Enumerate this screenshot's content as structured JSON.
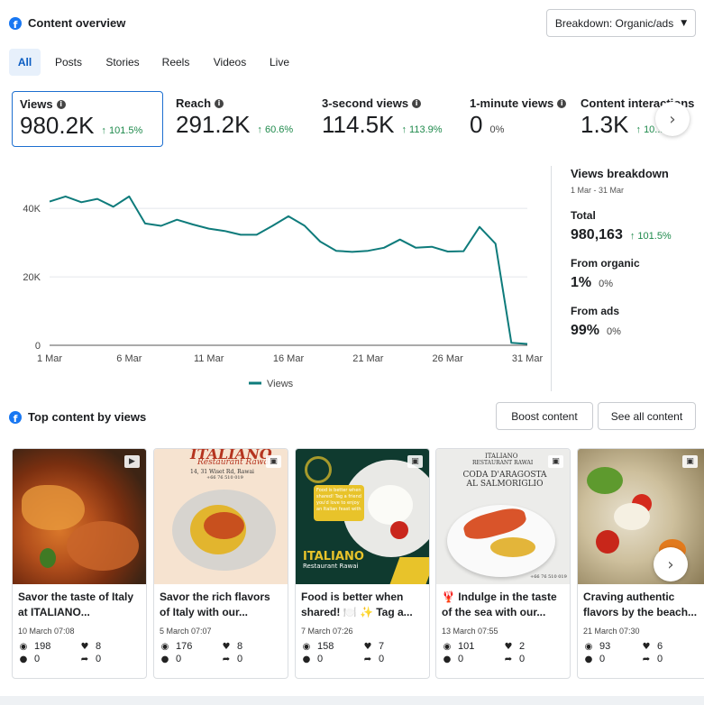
{
  "header": {
    "title": "Content overview",
    "breakdown_button": "Breakdown: Organic/ads"
  },
  "tabs": [
    {
      "label": "All",
      "active": true
    },
    {
      "label": "Posts",
      "active": false
    },
    {
      "label": "Stories",
      "active": false
    },
    {
      "label": "Reels",
      "active": false
    },
    {
      "label": "Videos",
      "active": false
    },
    {
      "label": "Live",
      "active": false
    }
  ],
  "metrics": [
    {
      "label": "Views",
      "value": "980.2K",
      "delta": "101.5%",
      "active": true,
      "has_arrow": true
    },
    {
      "label": "Reach",
      "value": "291.2K",
      "delta": "60.6%",
      "active": false,
      "has_arrow": true
    },
    {
      "label": "3-second views",
      "value": "114.5K",
      "delta": "113.9%",
      "active": false,
      "has_arrow": true
    },
    {
      "label": "1-minute views",
      "value": "0",
      "delta": "0%",
      "active": false,
      "has_arrow": false
    },
    {
      "label": "Content interactions",
      "value": "1.3K",
      "delta": "10...",
      "active": false,
      "has_arrow": true
    }
  ],
  "chart_data": {
    "type": "line",
    "title": "",
    "xlabel": "",
    "ylabel": "",
    "x": [
      "1 Mar",
      "2 Mar",
      "3 Mar",
      "4 Mar",
      "5 Mar",
      "6 Mar",
      "7 Mar",
      "8 Mar",
      "9 Mar",
      "10 Mar",
      "11 Mar",
      "12 Mar",
      "13 Mar",
      "14 Mar",
      "15 Mar",
      "16 Mar",
      "17 Mar",
      "18 Mar",
      "19 Mar",
      "20 Mar",
      "21 Mar",
      "22 Mar",
      "23 Mar",
      "24 Mar",
      "25 Mar",
      "26 Mar",
      "27 Mar",
      "28 Mar",
      "29 Mar",
      "30 Mar",
      "31 Mar"
    ],
    "x_tick_labels": [
      "1 Mar",
      "6 Mar",
      "11 Mar",
      "16 Mar",
      "21 Mar",
      "26 Mar",
      "31 Mar"
    ],
    "y_tick_labels": [
      "0",
      "20K",
      "40K"
    ],
    "ylim": [
      0,
      44000
    ],
    "grid": true,
    "legend": "bottom-center",
    "series": [
      {
        "name": "Views",
        "color": "#0e7b7b",
        "values": [
          42000,
          43500,
          41800,
          42800,
          40500,
          43500,
          35600,
          34900,
          36700,
          35300,
          34100,
          33400,
          32300,
          32300,
          34900,
          37700,
          35000,
          30300,
          27600,
          27300,
          27600,
          28500,
          30900,
          28500,
          28800,
          27400,
          27500,
          34600,
          29700,
          700,
          400
        ]
      }
    ]
  },
  "breakdown": {
    "title": "Views breakdown",
    "date_range": "1 Mar - 31 Mar",
    "items": [
      {
        "label": "Total",
        "value": "980,163",
        "delta": "101.5%",
        "has_arrow": true
      },
      {
        "label": "From organic",
        "value": "1%",
        "delta": "0%",
        "has_arrow": false
      },
      {
        "label": "From ads",
        "value": "99%",
        "delta": "0%",
        "has_arrow": false
      }
    ]
  },
  "top_content": {
    "title": "Top content by views",
    "boost_button": "Boost content",
    "see_all_button": "See all content",
    "cards": [
      {
        "caption": "Savor the taste of Italy at ITALIANO...",
        "date": "10 March 07:08",
        "views": "198",
        "likes": "8",
        "comments": "0",
        "shares": "0",
        "type_icon": "video-icon"
      },
      {
        "caption": "Savor the rich flavors of Italy with our...",
        "date": "5 March 07:07",
        "views": "176",
        "likes": "8",
        "comments": "0",
        "shares": "0",
        "type_icon": "photo-icon",
        "thumb_title": "ITALIANO",
        "thumb_subtitle": "Restaurant Rawai",
        "thumb_address": "14, 31 Wiset Rd, Rawai",
        "thumb_phone": "+66 76 510 019"
      },
      {
        "caption": "Food is better when shared! 🍽️ ✨ Tag a...",
        "date": "7 March 07:26",
        "views": "158",
        "likes": "7",
        "comments": "0",
        "shares": "0",
        "type_icon": "photo-icon",
        "thumb_title": "ITALIANO",
        "thumb_subtitle": "Restaurant Rawai",
        "thumb_bubble": "Food is better when shared! Tag a friend you'd love to enjoy an Italian feast with"
      },
      {
        "caption": "🦞 Indulge in the taste of the sea with our...",
        "date": "13 March 07:55",
        "views": "101",
        "likes": "2",
        "comments": "0",
        "shares": "0",
        "type_icon": "photo-icon",
        "thumb_title": "ITALIANO",
        "thumb_subtitle": "RESTAURANT RAWAI",
        "thumb_dish": "CODA D'ARAGOSTA AL SALMORIGLIO",
        "thumb_phone": "+66 76 510 019"
      },
      {
        "caption": "Craving authentic flavors by the beach...",
        "date": "21 March 07:30",
        "views": "93",
        "likes": "6",
        "comments": "0",
        "shares": "0",
        "type_icon": "photo-icon"
      }
    ]
  }
}
